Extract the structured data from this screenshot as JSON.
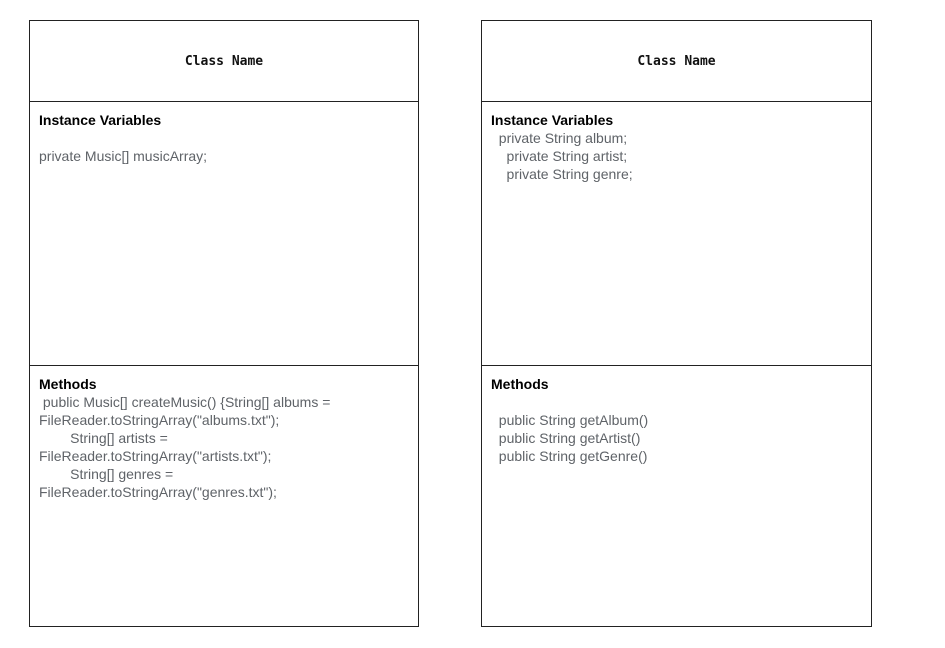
{
  "left_class": {
    "name": "Class Name",
    "vars_heading": "Instance Variables",
    "vars": [
      "private Music[] musicArray;"
    ],
    "methods_heading": "Methods",
    "methods": [
      " public Music[] createMusic() {String[] albums =",
      "FileReader.toStringArray(\"albums.txt\");",
      "        String[] artists =",
      "FileReader.toStringArray(\"artists.txt\");",
      "        String[] genres =",
      "FileReader.toStringArray(\"genres.txt\");"
    ]
  },
  "right_class": {
    "name": "Class Name",
    "vars_heading": "Instance Variables",
    "vars": [
      "  private String album;",
      "    private String artist;",
      "    private String genre;"
    ],
    "methods_heading": "Methods",
    "methods": [
      "  public String getAlbum()",
      "  public String getArtist()",
      "  public String getGenre()"
    ]
  }
}
